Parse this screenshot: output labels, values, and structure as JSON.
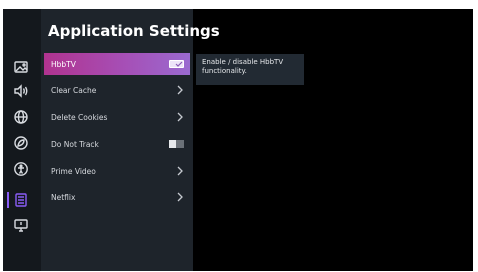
{
  "header": {
    "title": "Application Settings"
  },
  "rail": {
    "icons": [
      {
        "name": "picture-icon"
      },
      {
        "name": "sound-icon"
      },
      {
        "name": "network-icon"
      },
      {
        "name": "power-icon"
      },
      {
        "name": "accessibility-icon"
      },
      {
        "name": "apps-icon"
      },
      {
        "name": "system-icon"
      }
    ],
    "selected_icon": "apps-icon"
  },
  "menu": {
    "items": [
      {
        "label": "HbbTV",
        "control": "toggle",
        "state": "on",
        "active": true
      },
      {
        "label": "Clear Cache",
        "control": "chevron"
      },
      {
        "label": "Delete Cookies",
        "control": "chevron"
      },
      {
        "label": "Do Not Track",
        "control": "toggle",
        "state": "off"
      },
      {
        "label": "Prime Video",
        "control": "chevron"
      },
      {
        "label": "Netflix",
        "control": "chevron"
      }
    ]
  },
  "tooltip": {
    "text": "Enable / disable HbbTV functionality."
  },
  "colors": {
    "highlight_start": "#b0338f",
    "highlight_end": "#9a6ad0",
    "accent": "#8a5cf6",
    "panel_bg": "#1e242b"
  }
}
